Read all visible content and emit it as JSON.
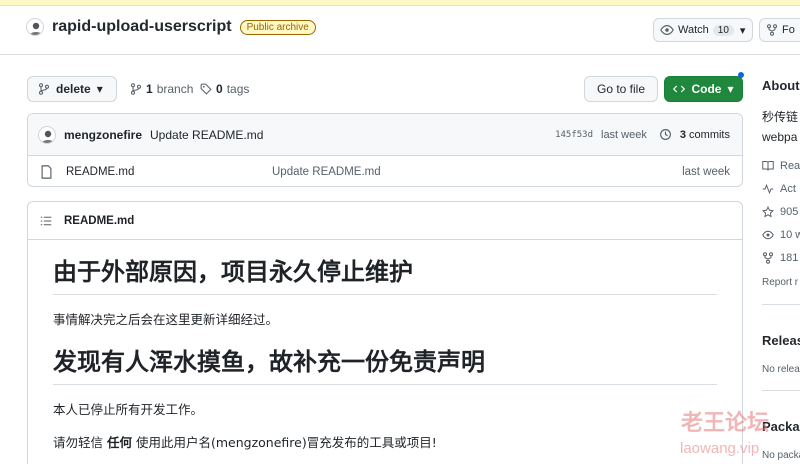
{
  "repo": {
    "name": "rapid-upload-userscript",
    "badge": "Public archive",
    "watch_label": "Watch",
    "watch_count": "10",
    "fork_label": "Fo"
  },
  "toolbar": {
    "branch": "delete",
    "branch_count": "1",
    "branch_word": "branch",
    "tag_count": "0",
    "tag_word": "tags",
    "goto_label": "Go to file",
    "code_label": "Code"
  },
  "commit": {
    "author": "mengzonefire",
    "message": "Update README.md",
    "sha": "145f53d",
    "time": "last week",
    "commits_count": "3",
    "commits_word": "commits"
  },
  "files": [
    {
      "name": "README.md",
      "message": "Update README.md",
      "time": "last week"
    }
  ],
  "readme": {
    "header": "README.md",
    "h1_a": "由于外部原因，项目永久停止维护",
    "p1": "事情解决完之后会在这里更新详细经过。",
    "h1_b": "发现有人浑水摸鱼，故补充一份免责声明",
    "p2": "本人已停止所有开发工作。",
    "p3_pre": "请勿轻信 ",
    "p3_bold": "任何",
    "p3_post": " 使用此用户名(mengzonefire)冒充发布的工具或项目!"
  },
  "sidebar": {
    "about": "About",
    "desc1": "秒传链",
    "desc2": "webpa",
    "readme": "Rea",
    "activity": "Act",
    "stars": "905",
    "watching": "10 w",
    "forks": "181",
    "report": "Report r",
    "releases": "Releas",
    "no_releases": "No releas",
    "packages": "Packag",
    "no_packages": "No packa"
  },
  "watermark": {
    "line1": "老王论坛",
    "line2": "laowang.vip"
  }
}
